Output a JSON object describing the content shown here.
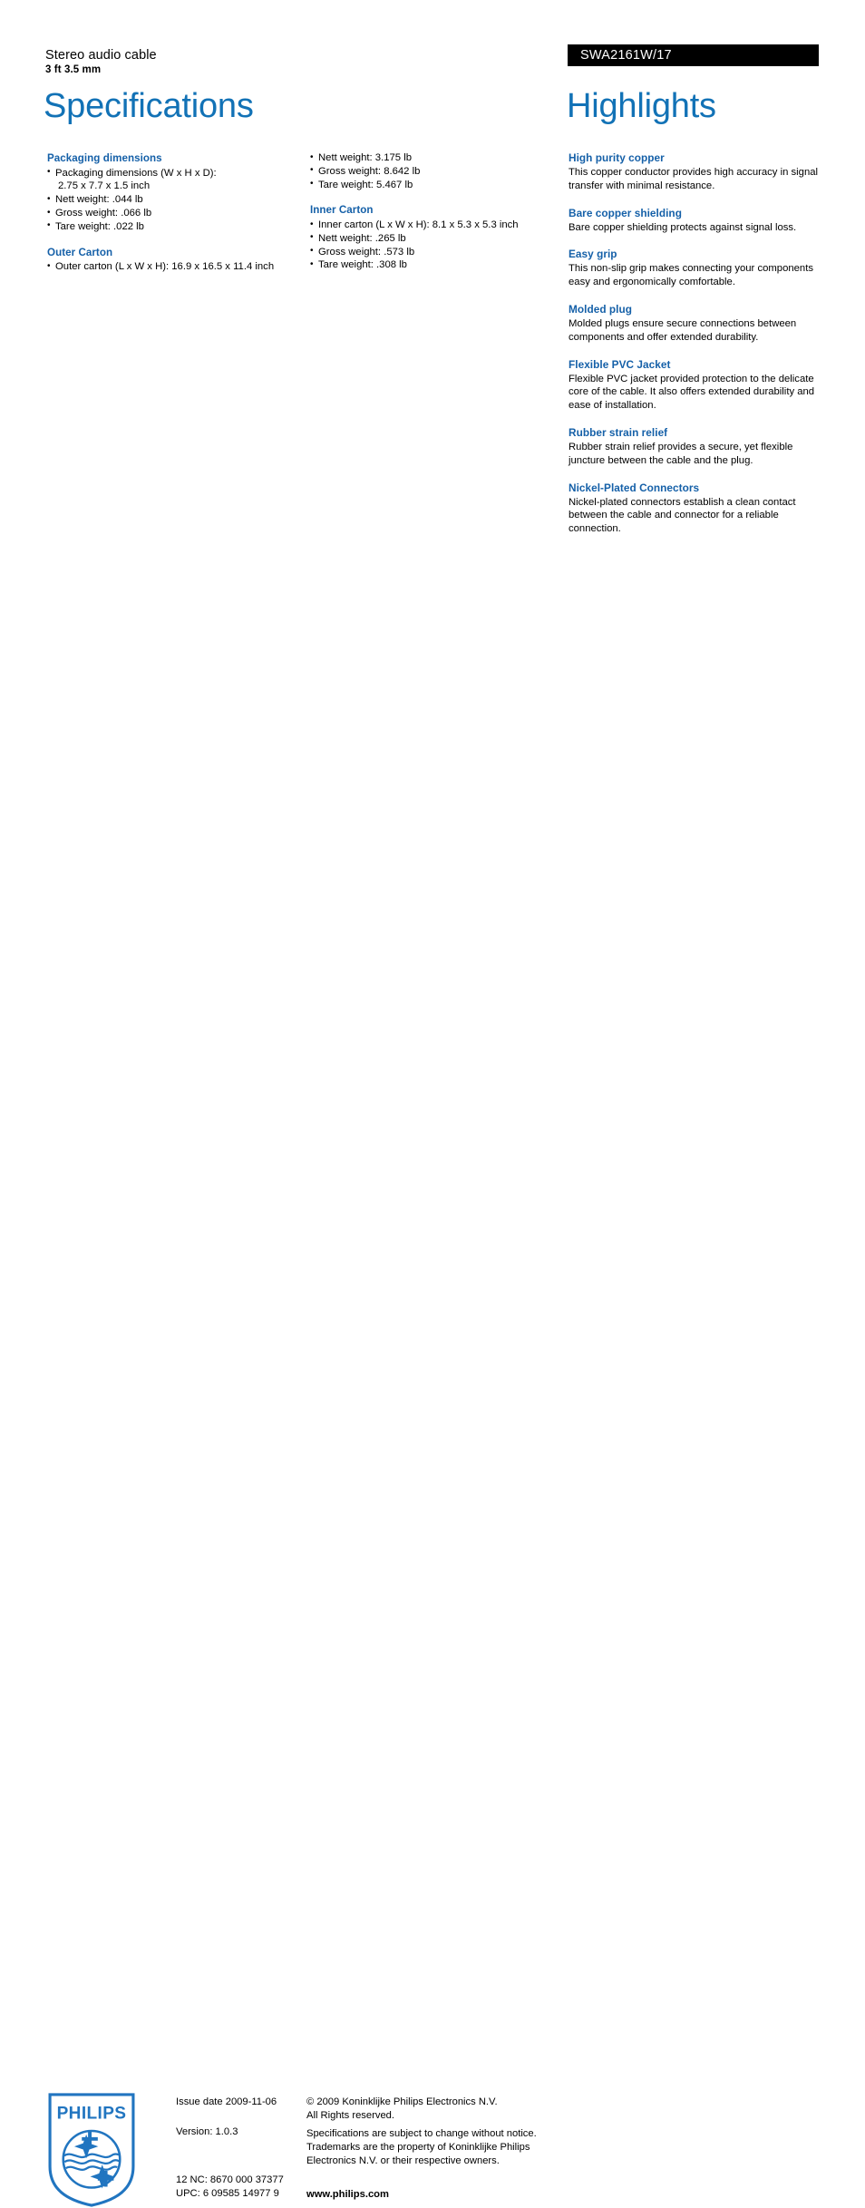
{
  "header": {
    "product_title": "Stereo audio cable",
    "product_subtitle": "3 ft 3.5 mm",
    "product_code": "SWA2161W/17",
    "spec_heading": "Specifications",
    "highlights_heading": "Highlights",
    "accent_color": "#1272b6",
    "section_title_color": "#1560a8",
    "code_bar_color": "#000000"
  },
  "specifications": {
    "column_1": [
      {
        "title": "Packaging dimensions",
        "items": [
          {
            "text": "Packaging dimensions (W x H x D):",
            "continuation": "2.75 x 7.7 x 1.5 inch"
          },
          {
            "text": "Nett weight: .044 lb"
          },
          {
            "text": "Gross weight: .066 lb"
          },
          {
            "text": "Tare weight: .022 lb"
          }
        ]
      },
      {
        "title": "Outer Carton",
        "items": [
          {
            "text": "Outer carton (L x W x H): 16.9 x 16.5 x 11.4 inch"
          }
        ]
      }
    ],
    "column_2": [
      {
        "title": "",
        "items": [
          {
            "text": "Nett weight: 3.175 lb"
          },
          {
            "text": "Gross weight: 8.642 lb"
          },
          {
            "text": "Tare weight: 5.467 lb"
          }
        ]
      },
      {
        "title": "Inner Carton",
        "items": [
          {
            "text": "Inner carton (L x W x H): 8.1 x 5.3 x 5.3 inch"
          },
          {
            "text": "Nett weight: .265 lb"
          },
          {
            "text": "Gross weight: .573 lb"
          },
          {
            "text": "Tare weight: .308 lb"
          }
        ]
      }
    ]
  },
  "highlights": [
    {
      "title": "High purity copper",
      "body": "This copper conductor provides high accuracy in signal transfer with minimal resistance."
    },
    {
      "title": "Bare copper shielding",
      "body": "Bare copper shielding protects against signal loss."
    },
    {
      "title": "Easy grip",
      "body": "This non-slip grip makes connecting your components easy and ergonomically comfortable."
    },
    {
      "title": "Molded plug",
      "body": "Molded plugs ensure secure connections between components and offer extended durability."
    },
    {
      "title": "Flexible PVC Jacket",
      "body": "Flexible PVC jacket provided protection to the delicate core of the cable. It also offers extended durability and ease of installation."
    },
    {
      "title": "Rubber strain relief",
      "body": "Rubber strain relief provides a secure, yet flexible juncture between the cable and the plug."
    },
    {
      "title": "Nickel-Plated Connectors",
      "body": "Nickel-plated connectors establish a clean contact between the cable and connector for a reliable connection."
    }
  ],
  "footer": {
    "logo_text": "PHILIPS",
    "logo_color": "#2175c0",
    "issue_date": "Issue date 2009-11-06",
    "version": "Version: 1.0.3",
    "nc_code": "12 NC: 8670 000 37377",
    "upc_code": "UPC: 6 09585 14977 9",
    "copyright_line_1": "© 2009 Koninklijke Philips Electronics N.V.",
    "copyright_line_2": "All Rights reserved.",
    "legal_text": "Specifications are subject to change without notice. Trademarks are the property of Koninklijke Philips Electronics N.V. or their respective owners.",
    "website": "www.philips.com"
  }
}
